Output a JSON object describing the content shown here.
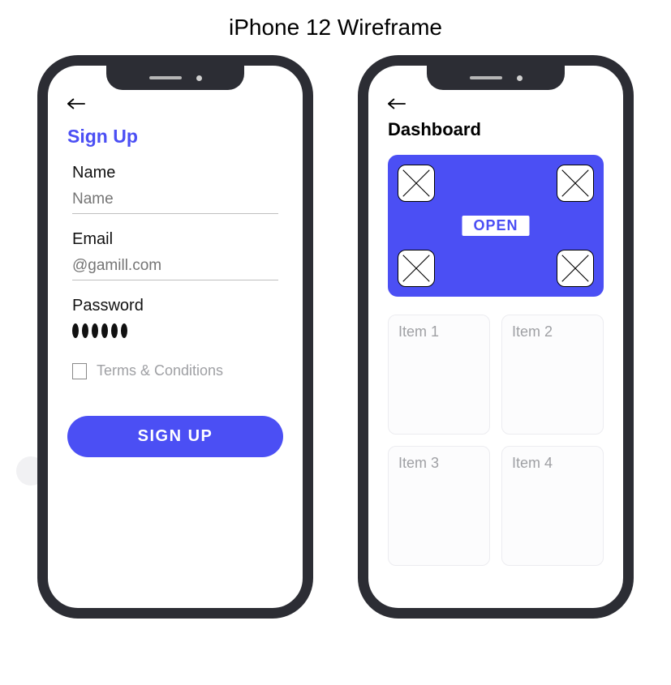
{
  "page": {
    "title": "iPhone 12 Wireframe"
  },
  "phone_signup": {
    "heading": "Sign Up",
    "fields": {
      "name": {
        "label": "Name",
        "placeholder": "Name"
      },
      "email": {
        "label": "Email",
        "placeholder": "@gamill.com"
      },
      "password": {
        "label": "Password",
        "dot_count": 6
      }
    },
    "terms_label": "Terms & Conditions",
    "submit_label": "SIGN  UP"
  },
  "phone_dashboard": {
    "heading": "Dashboard",
    "hero_badge": "OPEN",
    "items": [
      "Item 1",
      "Item 2",
      "Item 3",
      "Item 4"
    ]
  },
  "colors": {
    "accent": "#4b4ff4",
    "phone_frame": "#2c2d34",
    "muted_text": "#9fa0a4"
  }
}
